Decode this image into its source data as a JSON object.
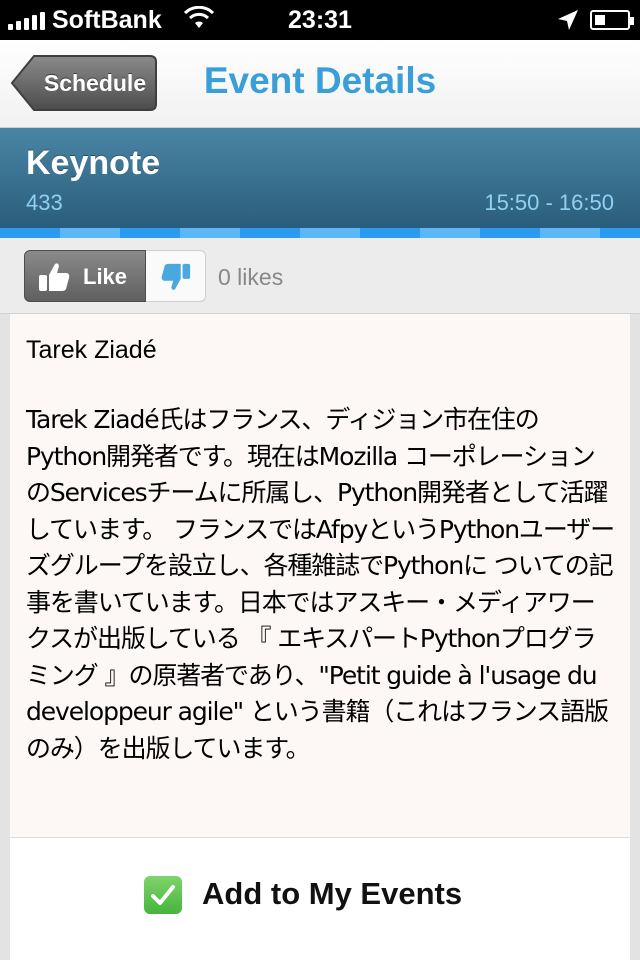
{
  "status_bar": {
    "carrier": "SoftBank",
    "time": "23:31",
    "icons": [
      "signal-icon",
      "wifi-icon",
      "location-icon",
      "battery-icon"
    ]
  },
  "nav": {
    "back_label": "Schedule",
    "title": "Event Details"
  },
  "event": {
    "title": "Keynote",
    "room": "433",
    "time": "15:50 - 16:50"
  },
  "likes": {
    "like_label": "Like",
    "count_text": "0 likes",
    "icons": [
      "thumbs-up-icon",
      "thumbs-down-icon"
    ]
  },
  "content": {
    "speaker": "Tarek Ziadé",
    "description": "Tarek Ziadé氏はフランス、ディジョン市在住のPython開発者です。現在はMozilla コーポレーションのServicesチームに所属し、Python開発者として活躍しています。 フランスではAfpyというPythonユーザーズグループを設立し、各種雑誌でPythonに ついての記事を書いています。日本ではアスキー・メディアワークスが出版している 『 エキスパートPythonプログラミング 』の原著者であり、\"Petit guide à l'usage du developpeur agile\" という書籍（これはフランス語版のみ）を出版しています。"
  },
  "actions": {
    "add_label": "Add to My Events",
    "icon": "checkmark-icon"
  },
  "colors": {
    "nav_title": "#3a9ed8",
    "header_bg": "#2a5d7b",
    "header_sub": "#8fd0f5",
    "stripe": "#2b9bef",
    "check": "#46b43c"
  }
}
